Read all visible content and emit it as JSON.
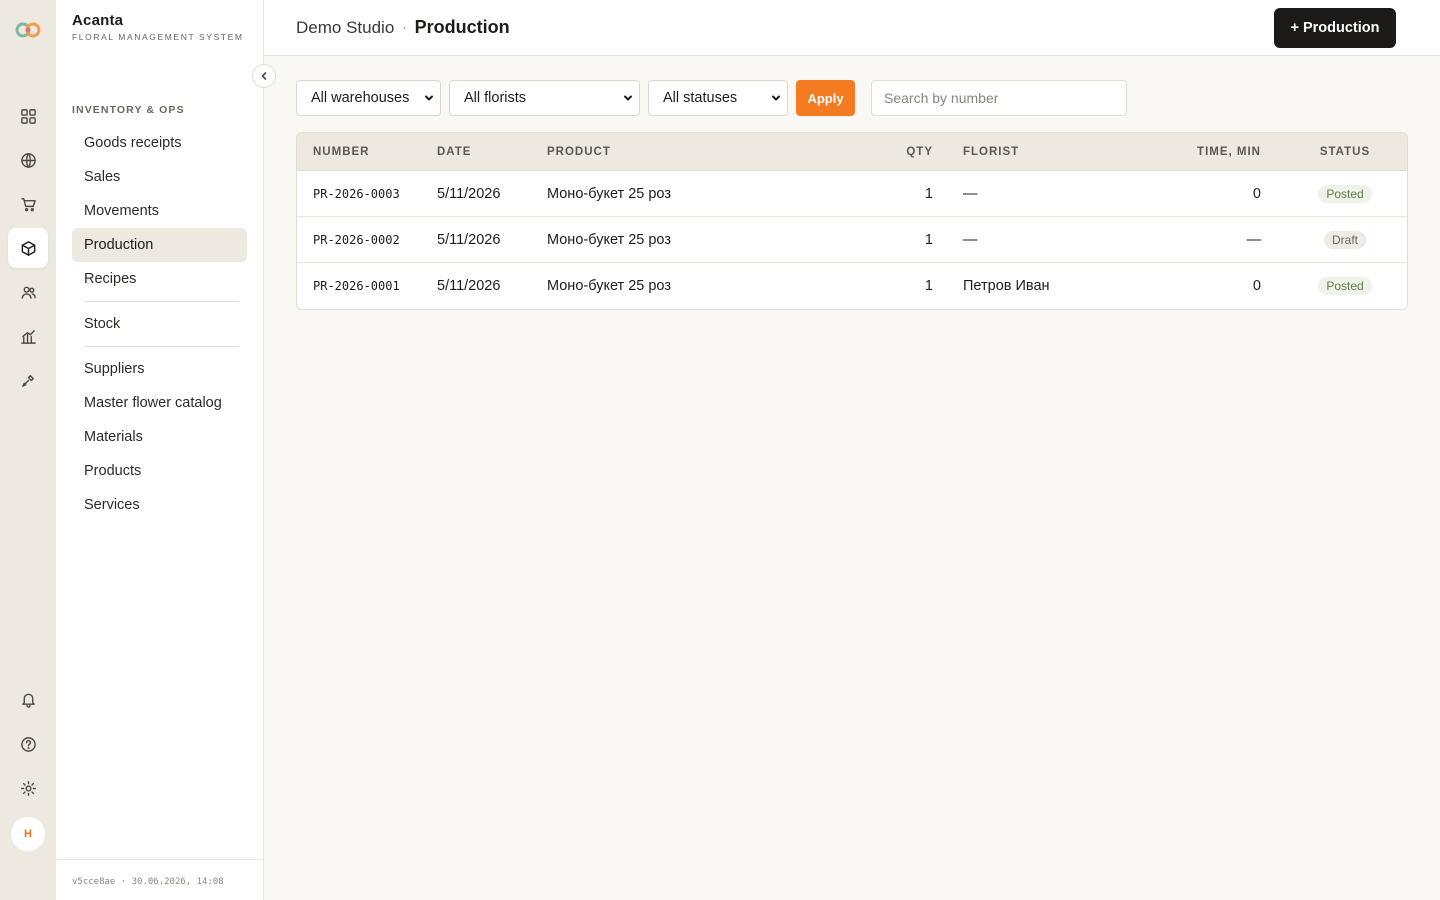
{
  "app": {
    "name": "Acanta",
    "tagline": "FLORAL MANAGEMENT SYSTEM",
    "version": "v5cce8ae · 30.06.2026, 14:08"
  },
  "rail": {
    "items": [
      {
        "icon": "dashboard-icon"
      },
      {
        "icon": "globe-icon"
      },
      {
        "icon": "cart-icon"
      },
      {
        "icon": "box-icon",
        "active": true
      },
      {
        "icon": "users-icon"
      },
      {
        "icon": "chart-icon"
      },
      {
        "icon": "tools-icon"
      }
    ],
    "bottom": [
      {
        "icon": "bell-icon"
      },
      {
        "icon": "help-icon"
      },
      {
        "icon": "settings-icon"
      }
    ],
    "avatar_initial": "H"
  },
  "sidebar": {
    "section_label": "INVENTORY & OPS",
    "groups": [
      [
        "Goods receipts",
        "Sales",
        "Movements",
        "Production",
        "Recipes"
      ],
      [
        "Stock"
      ],
      [
        "Suppliers",
        "Master flower catalog",
        "Materials",
        "Products",
        "Services"
      ]
    ],
    "active": "Production"
  },
  "header": {
    "studio": "Demo Studio",
    "separator": "·",
    "current": "Production",
    "add_button": "+ Production"
  },
  "filters": {
    "warehouse": "All warehouses",
    "florist": "All florists",
    "status": "All statuses",
    "apply_label": "Apply",
    "search_placeholder": "Search by number"
  },
  "table": {
    "columns": [
      "NUMBER",
      "DATE",
      "PRODUCT",
      "QTY",
      "FLORIST",
      "TIME, MIN",
      "STATUS"
    ],
    "rows": [
      {
        "number": "PR-2026-0003",
        "date": "5/11/2026",
        "product": "Моно-букет 25 роз",
        "qty": "1",
        "florist": "—",
        "time": "0",
        "status": "Posted"
      },
      {
        "number": "PR-2026-0002",
        "date": "5/11/2026",
        "product": "Моно-букет 25 роз",
        "qty": "1",
        "florist": "—",
        "time": "—",
        "status": "Draft"
      },
      {
        "number": "PR-2026-0001",
        "date": "5/11/2026",
        "product": "Моно-букет 25 роз",
        "qty": "1",
        "florist": "Петров Иван",
        "time": "0",
        "status": "Posted"
      }
    ]
  },
  "colors": {
    "accent": "#f47b20",
    "primary_button": "#1b1a18",
    "rail_bg": "#ede9e1",
    "posted": "#5f7d4b"
  }
}
